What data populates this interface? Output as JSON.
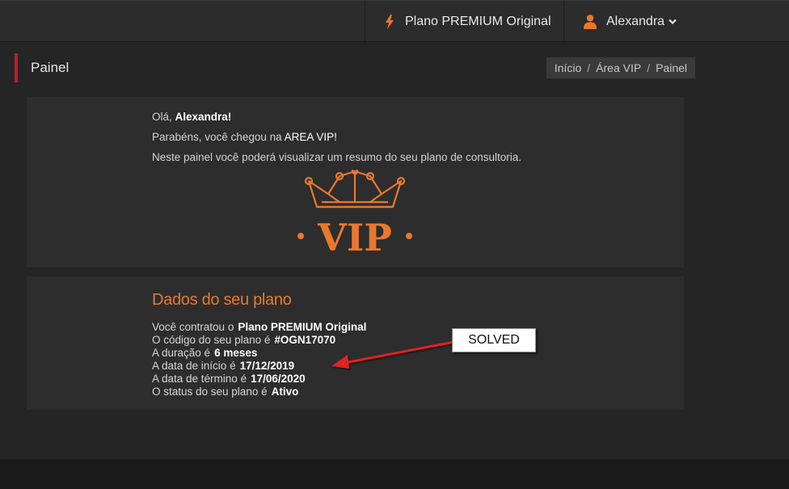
{
  "topbar": {
    "plan_label": "Plano PREMIUM Original",
    "user_name": "Alexandra",
    "plan_icon": "bolt-icon",
    "user_icon": "user-icon",
    "accent_color": "#e8782d"
  },
  "header": {
    "title": "Painel",
    "breadcrumb": [
      "Início",
      "Área VIP",
      "Painel"
    ],
    "separator": "/"
  },
  "welcome": {
    "greeting_prefix": "Olá,",
    "greeting_name": "Alexandra!",
    "line2_prefix": "Parabéns, você chegou na",
    "line2_highlight": "AREA VIP!",
    "line3": "Neste painel você poderá visualizar um resumo do seu plano de consultoria.",
    "logo_text": "VIP"
  },
  "plan": {
    "title": "Dados do seu plano",
    "rows": [
      {
        "label": "Você contratou o",
        "value": "Plano PREMIUM Original"
      },
      {
        "label": "O código do seu plano é",
        "value": "#OGN17070"
      },
      {
        "label": "A duração é",
        "value": "6 meses"
      },
      {
        "label": "A data de início é",
        "value": "17/12/2019"
      },
      {
        "label": "A data de término é",
        "value": "17/06/2020"
      },
      {
        "label": "O status do seu plano é",
        "value": "Ativo"
      }
    ]
  },
  "annotation": {
    "label": "SOLVED",
    "arrow_color": "#e02020"
  }
}
